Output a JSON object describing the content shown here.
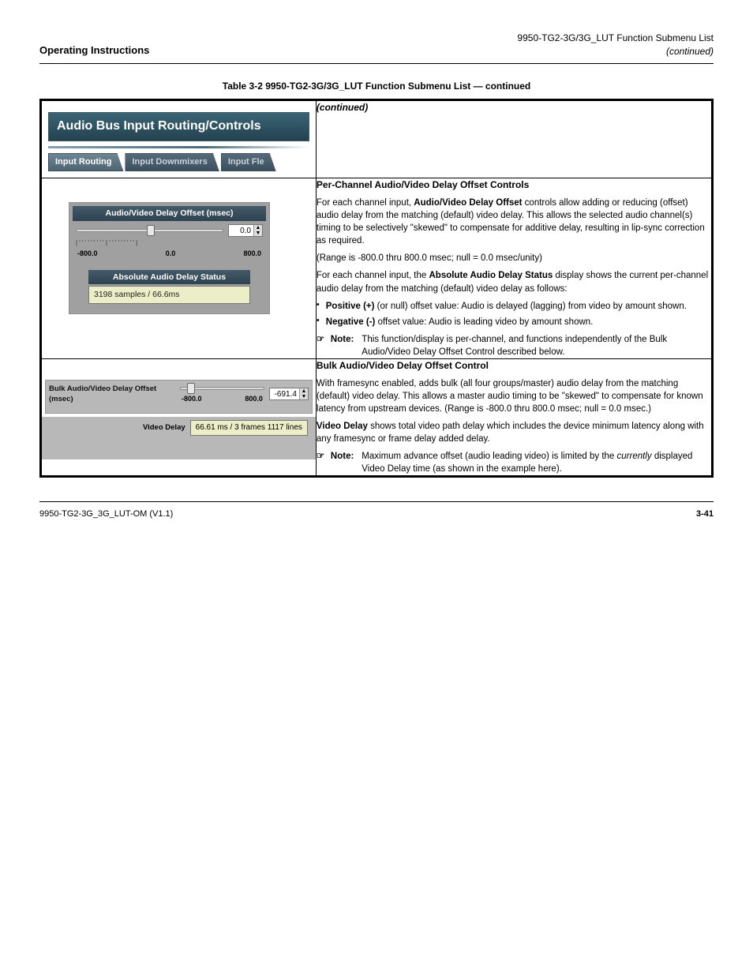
{
  "header": {
    "left": "Operating Instructions",
    "right_product": "9950-TG2-3G/3G_LUT Function Submenu List",
    "right_cont": "(continued)"
  },
  "caption": "Table 3-2     9950-TG2-3G/3G_LUT Function Submenu List — continued",
  "panel": {
    "title": "Audio Bus Input Routing/Controls",
    "tabs": [
      "Input Routing",
      "Input Downmixers",
      "Input Fle"
    ]
  },
  "controls": {
    "av_offset_label": "Audio/Video Delay Offset (msec)",
    "av_offset_value": "0.0",
    "ticks": {
      "min": "-800.0",
      "mid": "0.0",
      "max": "800.0"
    },
    "abs_status_label": "Absolute Audio Delay Status",
    "abs_status_value": "3198 samples / 66.6ms",
    "bulk_label": "Bulk Audio/Video Delay Offset (msec)",
    "bulk_value": "-691.4",
    "bulk_ticks": {
      "min": "-800.0",
      "max": "800.0"
    },
    "video_delay_label": "Video Delay",
    "video_delay_value": "66.61 ms / 3 frames 1117 lines"
  },
  "right": {
    "row1_title": "(continued)",
    "row2": {
      "title": "Per-Channel Audio/Video Delay Offset Controls",
      "body_prefix": "For each channel input, ",
      "body_bold": "Audio/Video Delay Offset",
      "body_suffix": " controls allow adding or reducing (offset) audio delay from the matching (default) video delay. This allows the selected audio channel(s) timing to be selectively \"skewed\" to compensate for additive delay, resulting in lip-sync correction as required.",
      "p2": "(Range is -800.0 thru 800.0 msec; null = 0.0 msec/unity)",
      "p3_prefix": "For each channel input, the ",
      "p3_bold": "Absolute Audio Delay Status",
      "p3_suffix": " display shows the current per-channel audio delay from the matching (default) video delay as follows:",
      "bullets": [
        {
          "label": "Positive (+)",
          "text": "(or null) offset value: Audio is delayed (lagging) from video by amount shown."
        },
        {
          "label": "Negative (-)",
          "text": "offset value: Audio is leading video by amount shown."
        }
      ],
      "note": "This function/display is per-channel, and functions independently of the Bulk Audio/Video Delay Offset Control described below."
    },
    "row3": {
      "title": "Bulk Audio/Video Delay Offset Control",
      "p1": "With framesync enabled, adds bulk (all four groups/master) audio delay from the matching (default) video delay. This allows a master audio timing to be \"skewed\" to compensate for known latency from upstream devices. (Range is -800.0 thru 800.0 msec; null = 0.0 msec.)",
      "p2_bold": "Video Delay",
      "p2_suffix": " shows total video path delay which includes the device minimum latency along with any framesync or frame delay added delay.",
      "note_prefix": "Maximum advance offset (audio leading video) is limited by the ",
      "note_ital": "currently",
      "note_suffix": " displayed Video Delay time (as shown in the example here)."
    }
  },
  "footer": {
    "left": "9950-TG2-3G_3G_LUT-OM (V1.1)",
    "right": "3-41"
  }
}
